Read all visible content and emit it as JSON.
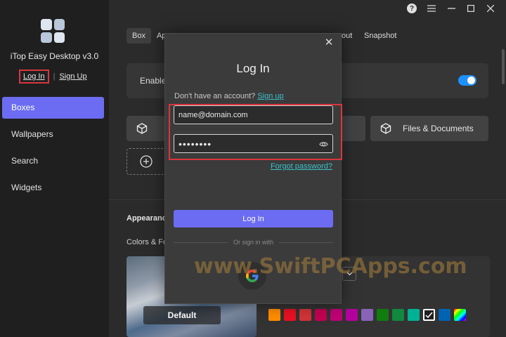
{
  "app": {
    "title": "iTop Easy Desktop v3.0",
    "login_link": "Log In",
    "signup_link": "Sign Up"
  },
  "sidebar": {
    "items": [
      {
        "label": "Boxes",
        "active": true
      },
      {
        "label": "Wallpapers",
        "active": false
      },
      {
        "label": "Search",
        "active": false
      },
      {
        "label": "Widgets",
        "active": false
      }
    ]
  },
  "titlebar": {
    "icons": [
      "help-icon",
      "menu-icon",
      "minimize-icon",
      "maximize-icon",
      "close-icon"
    ],
    "help": "?"
  },
  "tabs": {
    "box": "Box",
    "partial": "Ap",
    "about_fragment": "out",
    "snapshot": "Snapshot"
  },
  "settings": {
    "enable_label": "Enable",
    "toggle_on": true,
    "files_documents": "Files & Documents",
    "appearance": "Appearance",
    "colors_label": "Colors & Fo",
    "preview_label": "Default"
  },
  "swatches": [
    "#ff8c00",
    "#e81123",
    "#d13438",
    "#c30052",
    "#bf0077",
    "#b4009e",
    "#8764b8",
    "#107c10",
    "#10893e",
    "#00b294",
    "#1f1f1f",
    "#0063b1",
    "#rainbow"
  ],
  "modal": {
    "title": "Log In",
    "no_account": "Don't have an account?",
    "signup": "Sign up",
    "email_value": "name@domain.com",
    "password_value": "••••••••",
    "forgot": "Forgot password?",
    "login_button": "Log In",
    "or_text": "Or sign in with"
  },
  "watermark": "www.SwiftPCApps.com",
  "colors": {
    "accent": "#6c6cf2",
    "link": "#3bc2c9",
    "highlight": "#d9363e",
    "toggle": "#1e90ff"
  }
}
